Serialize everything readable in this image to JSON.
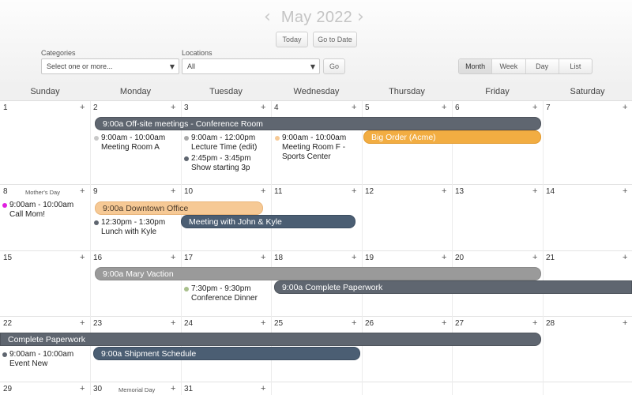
{
  "header": {
    "month_title": "May 2022",
    "prev_icon": "chevron-left-icon",
    "next_icon": "chevron-right-icon",
    "today_label": "Today",
    "goto_label": "Go to Date",
    "go_label": "Go"
  },
  "filters": {
    "categories": {
      "label": "Categories",
      "value": "Select one or more..."
    },
    "locations": {
      "label": "Locations",
      "value": "All"
    }
  },
  "views": {
    "month": "Month",
    "week": "Week",
    "day": "Day",
    "list": "List",
    "active": "Month"
  },
  "weekdays": [
    "Sunday",
    "Monday",
    "Tuesday",
    "Wednesday",
    "Thursday",
    "Friday",
    "Saturday"
  ],
  "weeks": [
    [
      "1",
      "2",
      "3",
      "4",
      "5",
      "6",
      "7"
    ],
    [
      "8",
      "9",
      "10",
      "11",
      "12",
      "13",
      "14"
    ],
    [
      "15",
      "16",
      "17",
      "18",
      "19",
      "20",
      "21"
    ],
    [
      "22",
      "23",
      "24",
      "25",
      "26",
      "27",
      "28"
    ],
    [
      "29",
      "30",
      "31",
      "",
      "",
      "",
      ""
    ]
  ],
  "add_symbol": "+",
  "holidays": {
    "mothers_day": "Mother's Day",
    "memorial_day": "Memorial Day"
  },
  "events": {
    "offsite": "9:00a Off-site meetings - Conference Room",
    "big_order": "Big Order (Acme)",
    "meeting_a": {
      "time": "9:00am - 10:00am",
      "title": "Meeting Room A",
      "color": "#c8c8c8"
    },
    "lecture": {
      "time": "9:00am - 12:00pm",
      "title": "Lecture Time (edit)",
      "color": "#a9a9a9"
    },
    "show": {
      "time": "2:45pm - 3:45pm",
      "title": "Show starting 3p",
      "color": "#5f6670"
    },
    "meeting_f": {
      "time": "9:00am - 10:00am",
      "title": "Meeting Room F -",
      "title2": "Sports Center",
      "color": "#f6c995"
    },
    "downtown": "9:00a Downtown Office",
    "call_mom": {
      "time": "9:00am - 10:00am",
      "title": "Call Mom!",
      "color": "#e020e0"
    },
    "lunch": {
      "time": "12:30pm - 1:30pm",
      "title": "Lunch with Kyle",
      "color": "#5f6670"
    },
    "john_kyle": "Meeting with John & Kyle",
    "mary": "9:00a Mary Vaction",
    "conference_dinner": {
      "time": "7:30pm - 9:30pm",
      "title": "Conference Dinner",
      "color": "#a9c08c"
    },
    "paperwork": "9:00a Complete Paperwork",
    "paperwork_cont": "Complete Paperwork",
    "shipment": "9:00a Shipment Schedule",
    "event_new": {
      "time": "9:00am - 10:00am",
      "title": "Event New",
      "color": "#5f6670"
    }
  }
}
